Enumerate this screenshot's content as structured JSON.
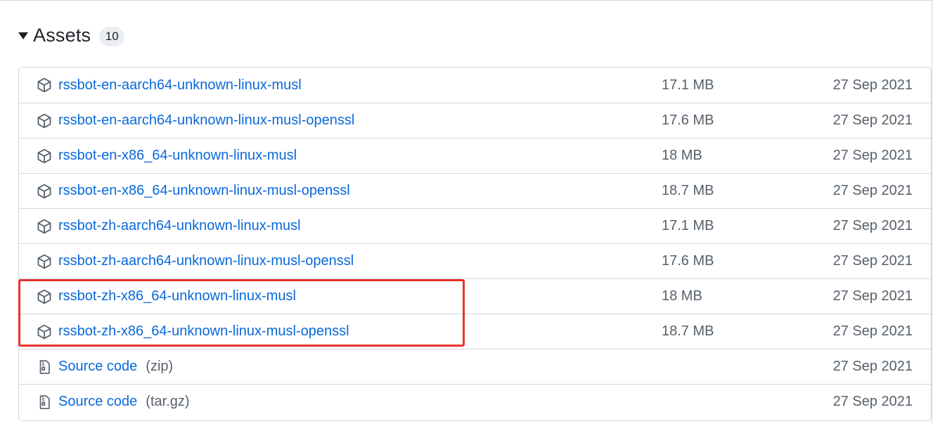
{
  "assets": {
    "title": "Assets",
    "count": "10",
    "files": [
      {
        "name": "rssbot-en-aarch64-unknown-linux-musl",
        "size": "17.1 MB",
        "date": "27 Sep 2021",
        "icon": "package-icon"
      },
      {
        "name": "rssbot-en-aarch64-unknown-linux-musl-openssl",
        "size": "17.6 MB",
        "date": "27 Sep 2021",
        "icon": "package-icon"
      },
      {
        "name": "rssbot-en-x86_64-unknown-linux-musl",
        "size": "18 MB",
        "date": "27 Sep 2021",
        "icon": "package-icon"
      },
      {
        "name": "rssbot-en-x86_64-unknown-linux-musl-openssl",
        "size": "18.7 MB",
        "date": "27 Sep 2021",
        "icon": "package-icon"
      },
      {
        "name": "rssbot-zh-aarch64-unknown-linux-musl",
        "size": "17.1 MB",
        "date": "27 Sep 2021",
        "icon": "package-icon"
      },
      {
        "name": "rssbot-zh-aarch64-unknown-linux-musl-openssl",
        "size": "17.6 MB",
        "date": "27 Sep 2021",
        "icon": "package-icon"
      },
      {
        "name": "rssbot-zh-x86_64-unknown-linux-musl",
        "size": "18 MB",
        "date": "27 Sep 2021",
        "icon": "package-icon"
      },
      {
        "name": "rssbot-zh-x86_64-unknown-linux-musl-openssl",
        "size": "18.7 MB",
        "date": "27 Sep 2021",
        "icon": "package-icon"
      }
    ],
    "source": [
      {
        "name": "Source code",
        "format": "(zip)",
        "date": "27 Sep 2021",
        "icon": "file-zip-icon"
      },
      {
        "name": "Source code",
        "format": "(tar.gz)",
        "date": "27 Sep 2021",
        "icon": "file-zip-icon"
      }
    ]
  },
  "colors": {
    "link": "#0969da",
    "muted": "#57606a",
    "highlight": "#e8322d"
  }
}
